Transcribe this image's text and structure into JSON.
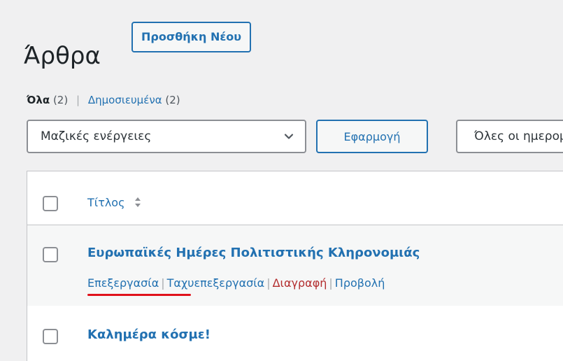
{
  "header": {
    "title": "Άρθρα",
    "add_new_label": "Προσθήκη Νέου"
  },
  "views": {
    "all_label": "Όλα",
    "all_count": "(2)",
    "separator": "|",
    "published_label": "Δημοσιευμένα",
    "published_count": "(2)"
  },
  "filters": {
    "bulk_actions_value": "Μαζικές ενέργειες",
    "apply_label": "Εφαρμογή",
    "dates_value": "Όλες οι ημερομηνίες"
  },
  "table": {
    "column_title": "Τίτλος",
    "rows": [
      {
        "title": "Ευρωπαϊκές Ημέρες Πολιτιστικής Κληρονομιάς",
        "actions": {
          "edit": "Επεξεργασία",
          "quick_edit": "Ταχυεπεξεργασία",
          "delete": "Διαγραφή",
          "view": "Προβολή"
        }
      },
      {
        "title": "Καλημέρα κόσμε!"
      }
    ]
  },
  "colors": {
    "link": "#2271b1",
    "delete": "#b32d2e",
    "annotation_underline": "#e0121b",
    "background": "#f0f0f1"
  }
}
